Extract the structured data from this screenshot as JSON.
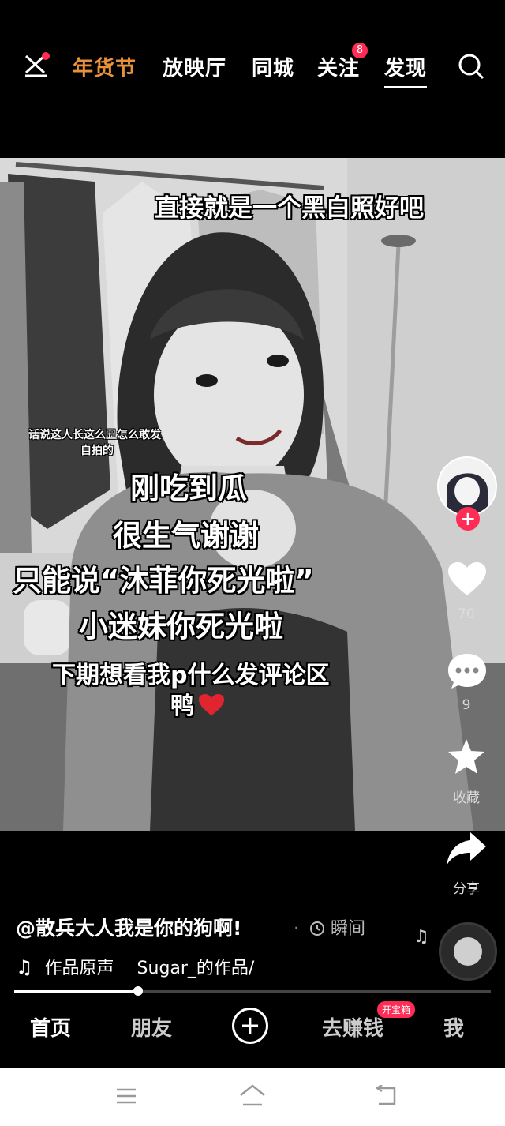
{
  "top_nav": {
    "tabs": [
      {
        "label": "年货节"
      },
      {
        "label": "放映厅"
      },
      {
        "label": "同城"
      },
      {
        "label": "关注"
      },
      {
        "label": "发现"
      }
    ],
    "follow_badge": "8",
    "festival_color": "#e7913a"
  },
  "video": {
    "captions": {
      "top": "直接就是一个黑白照好吧",
      "small_1": "话说这人长这么丑怎么敢发",
      "small_2": "自拍的",
      "line_1": "刚吃到瓜",
      "line_2": "很生气谢谢",
      "line_3": "只能说“沐菲你死光啦”",
      "line_4": "小迷妹你死光啦",
      "line_5": "下期想看我p什么发评论区",
      "line_6": "鸭"
    }
  },
  "side_actions": {
    "likes": "70",
    "comments": "9",
    "favorite_label": "收藏",
    "share_label": "分享"
  },
  "post": {
    "author": "@散兵大人我是你的狗啊!",
    "moment_label": "瞬间",
    "music": "作品原声",
    "music_author": "Sugar_的作品/"
  },
  "progress": 0.26,
  "bottom_nav": {
    "home": "首页",
    "friends": "朋友",
    "earn": "去赚钱",
    "earn_badge": "开宝箱",
    "me": "我"
  },
  "colors": {
    "accent": "#ff2d55",
    "heart": "#e0252f"
  }
}
